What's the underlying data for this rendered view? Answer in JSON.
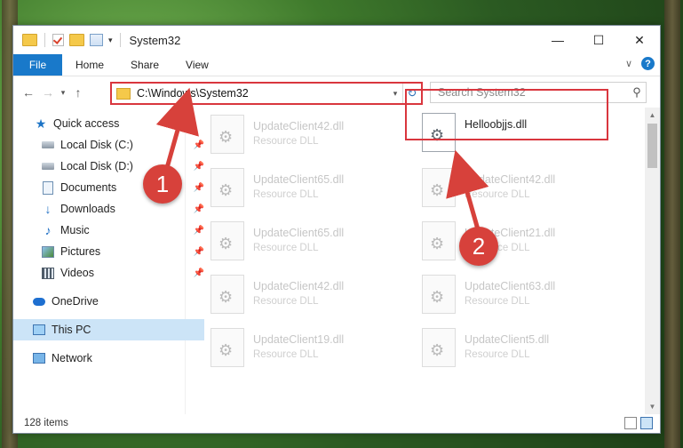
{
  "window": {
    "title": "System32"
  },
  "ribbon": {
    "tabs": [
      "File",
      "Home",
      "Share",
      "View"
    ]
  },
  "address": {
    "path": "C:\\Windows\\System32"
  },
  "search": {
    "placeholder": "Search System32"
  },
  "nav": {
    "quick_access": "Quick access",
    "items": [
      "Local Disk (C:)",
      "Local Disk (D:)",
      "Documents",
      "Downloads",
      "Music",
      "Pictures",
      "Videos"
    ],
    "onedrive": "OneDrive",
    "this_pc": "This PC",
    "network": "Network"
  },
  "files": {
    "left": [
      {
        "name": "UpdateClient42.dll",
        "type": "Resource DLL"
      },
      {
        "name": "UpdateClient65.dll",
        "type": "Resource DLL"
      },
      {
        "name": "UpdateClient65.dll",
        "type": "Resource DLL"
      },
      {
        "name": "UpdateClient42.dll",
        "type": "Resource DLL"
      },
      {
        "name": "UpdateClient19.dll",
        "type": "Resource DLL"
      }
    ],
    "right": [
      {
        "name": "Helloobjjs.dll",
        "type": ""
      },
      {
        "name": "UpdateClient42.dll",
        "type": "Resource DLL"
      },
      {
        "name": "UpdateClient21.dll",
        "type": "Resource DLL"
      },
      {
        "name": "UpdateClient63.dll",
        "type": "Resource DLL"
      },
      {
        "name": "UpdateClient5.dll",
        "type": "Resource DLL"
      }
    ]
  },
  "status": {
    "item_count": "128 items"
  },
  "callouts": [
    "1",
    "2"
  ],
  "colors": {
    "accent": "#1979ca",
    "highlight": "#d9363e",
    "callout": "#d7413b"
  }
}
